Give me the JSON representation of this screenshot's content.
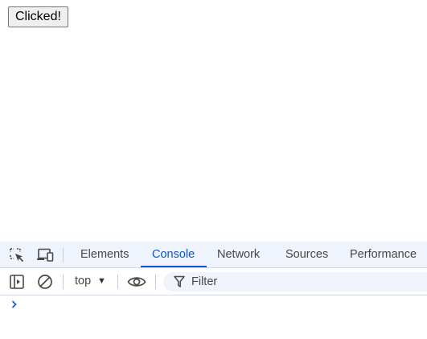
{
  "page": {
    "button_label": "Clicked!"
  },
  "devtools": {
    "tabs": [
      {
        "label": "Elements",
        "active": false
      },
      {
        "label": "Console",
        "active": true
      },
      {
        "label": "Network",
        "active": false
      },
      {
        "label": "Sources",
        "active": false
      },
      {
        "label": "Performance",
        "active": false
      }
    ],
    "toolbar": {
      "context": "top",
      "filter_placeholder": "Filter"
    },
    "icons": {
      "inspect": "inspect-element-icon",
      "device": "device-toolbar-icon",
      "sidebar": "sidebar-toggle-icon",
      "clear": "clear-console-icon",
      "eye": "live-expression-icon",
      "filter": "filter-icon",
      "prompt": "console-prompt-icon"
    },
    "accent_color": "#0b57d0"
  }
}
